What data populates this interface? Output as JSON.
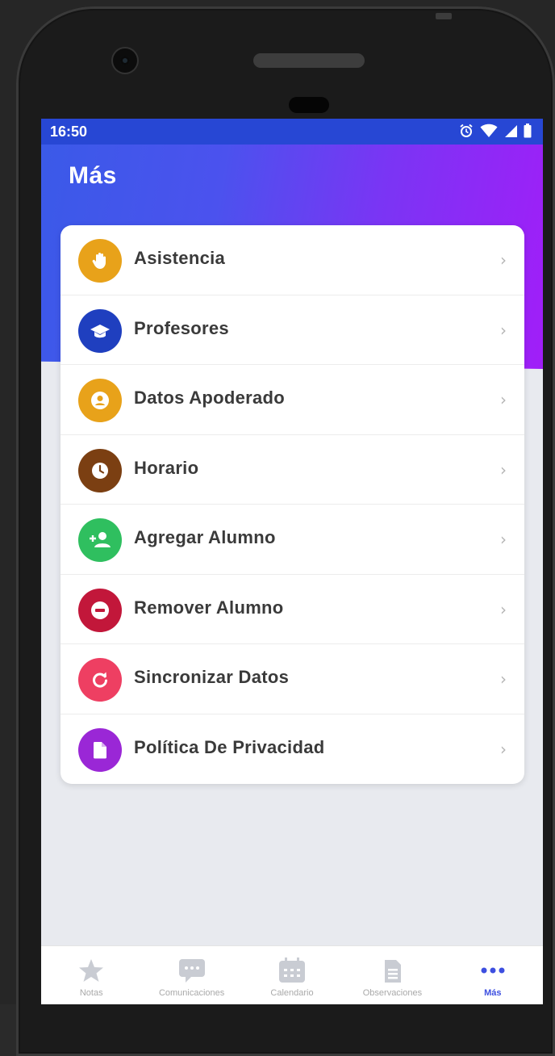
{
  "status_bar": {
    "time": "16:50",
    "icons": [
      "alarm-icon",
      "wifi-icon",
      "signal-icon",
      "battery-icon"
    ]
  },
  "header": {
    "title": "Más"
  },
  "menu": {
    "items": [
      {
        "label": "Asistencia",
        "icon": "hand-icon",
        "color": "#e8a21a"
      },
      {
        "label": "Profesores",
        "icon": "graduation-cap-icon",
        "color": "#1f3fbf"
      },
      {
        "label": "Datos Apoderado",
        "icon": "user-circle-icon",
        "color": "#e8a21a"
      },
      {
        "label": "Horario",
        "icon": "clock-icon",
        "color": "#7b3f12"
      },
      {
        "label": "Agregar Alumno",
        "icon": "add-user-icon",
        "color": "#2fbf5f"
      },
      {
        "label": "Remover Alumno",
        "icon": "remove-icon",
        "color": "#c2173a"
      },
      {
        "label": "Sincronizar Datos",
        "icon": "sync-icon",
        "color": "#ee3f62"
      },
      {
        "label": "Política De Privacidad",
        "icon": "document-icon",
        "color": "#9a27d6"
      }
    ],
    "chevron": "›"
  },
  "bottom_nav": {
    "items": [
      {
        "label": "Notas",
        "icon": "star-icon",
        "active": false
      },
      {
        "label": "Comunicaciones",
        "icon": "chat-icon",
        "active": false
      },
      {
        "label": "Calendario",
        "icon": "calendar-icon",
        "active": false
      },
      {
        "label": "Observaciones",
        "icon": "notes-icon",
        "active": false
      },
      {
        "label": "Más",
        "icon": "more-dots-icon",
        "active": true
      }
    ]
  },
  "colors": {
    "status_bar": "#2747d4",
    "header_gradient_start": "#3a5ae8",
    "header_gradient_end": "#a11ef8",
    "active_nav": "#3d4fe0",
    "inactive_nav": "#a9a9a9"
  }
}
